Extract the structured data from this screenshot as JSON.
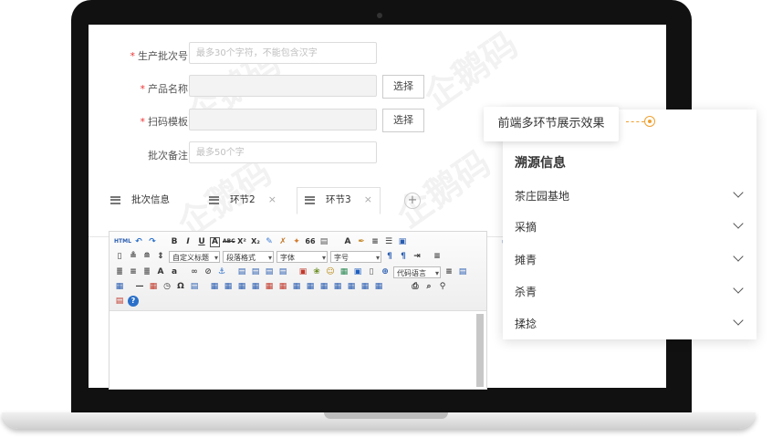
{
  "watermark": {
    "text": "企鹅码"
  },
  "form": {
    "fields": [
      {
        "label": "生产批次号：",
        "required": true,
        "placeholder": "最多30个字符，不能包含汉字"
      },
      {
        "label": "产品名称：",
        "required": true,
        "button": "选择"
      },
      {
        "label": "扫码模板：",
        "required": true,
        "button": "选择"
      },
      {
        "label": "批次备注：",
        "required": false,
        "placeholder": "最多50个字"
      }
    ]
  },
  "tabs": [
    {
      "label": "批次信息"
    },
    {
      "label": "环节2"
    },
    {
      "label": "环节3"
    }
  ],
  "tab_add": "+",
  "tab_close": "×",
  "editor": {
    "toolbar": {
      "html_btn": "HTML",
      "bold": "B",
      "italic": "I",
      "underline": "U",
      "strike": "ABC",
      "superscript": "X²",
      "subscript": "X₂",
      "quote": "66",
      "font_color": "A",
      "custom_title": "自定义标题",
      "paragraph": "段落格式",
      "font_family": "字体",
      "font_size": "字号",
      "code_lang": "代码语言"
    }
  },
  "popup": {
    "bubble_text": "前端多环节展示效果",
    "title": "溯源信息",
    "steps": [
      {
        "label": "茶庄园基地"
      },
      {
        "label": "采摘"
      },
      {
        "label": "摊青"
      },
      {
        "label": "杀青"
      },
      {
        "label": "揉捻"
      }
    ],
    "accent_color": "#f0a030"
  }
}
